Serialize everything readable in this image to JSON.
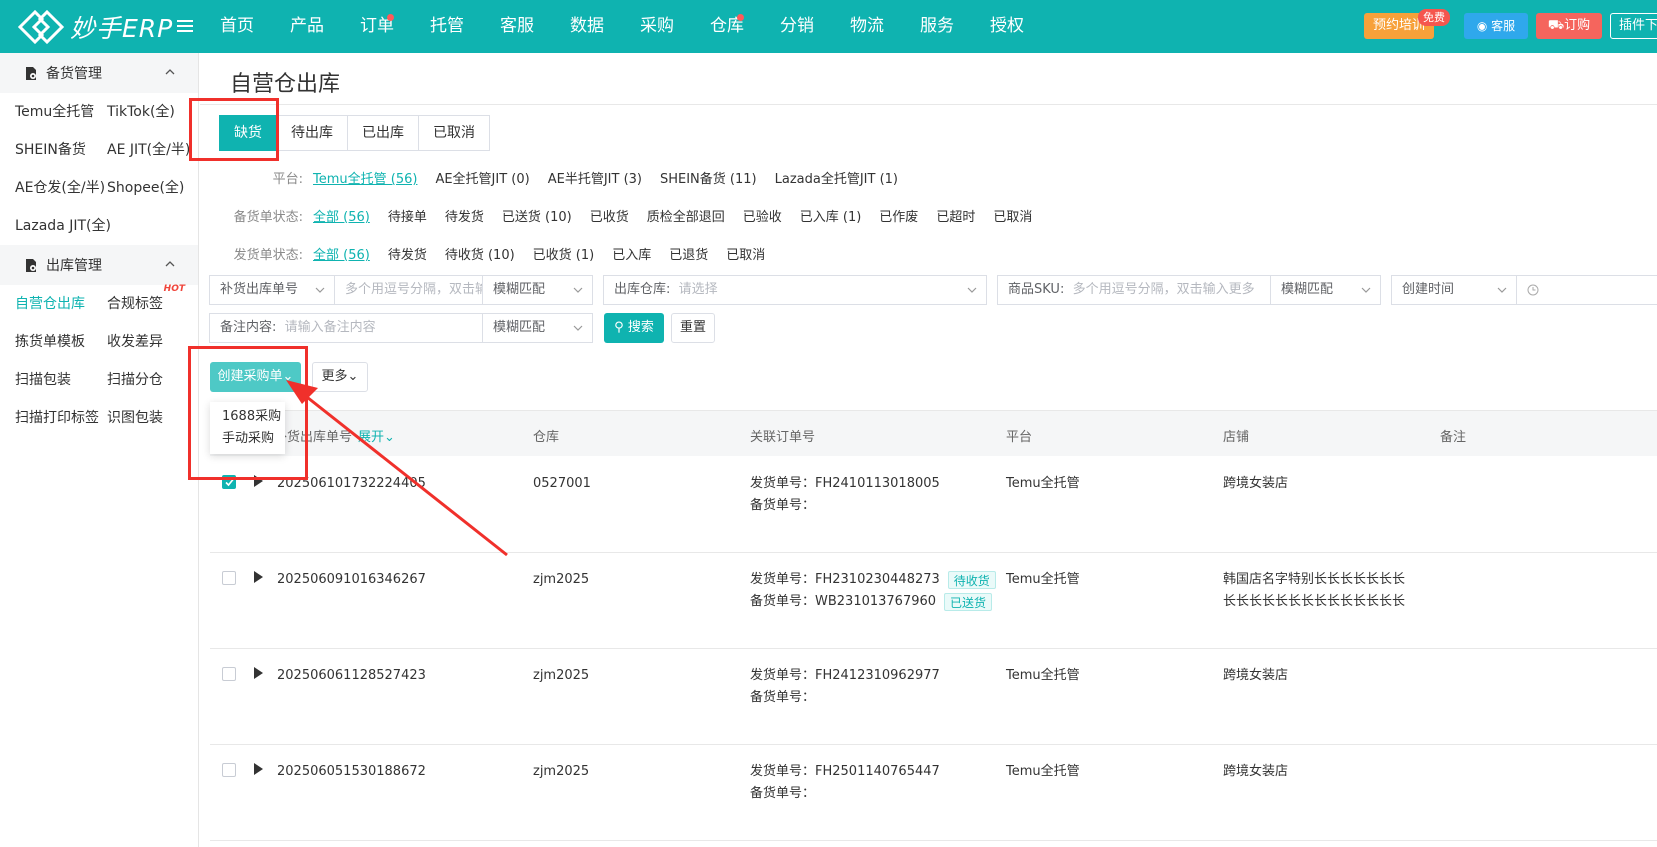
{
  "brand": {
    "name": "妙手ERP"
  },
  "topnav": {
    "items": [
      {
        "label": "首页",
        "dot": false
      },
      {
        "label": "产品",
        "dot": false
      },
      {
        "label": "订单",
        "dot": true
      },
      {
        "label": "托管",
        "dot": false
      },
      {
        "label": "客服",
        "dot": false
      },
      {
        "label": "数据",
        "dot": false
      },
      {
        "label": "采购",
        "dot": false
      },
      {
        "label": "仓库",
        "dot": true
      },
      {
        "label": "分销",
        "dot": false
      },
      {
        "label": "物流",
        "dot": false
      },
      {
        "label": "服务",
        "dot": false
      },
      {
        "label": "授权",
        "dot": false
      }
    ],
    "train_label": "预约培训",
    "free_badge": "免费",
    "cs_label": "客服",
    "order_label": "订购",
    "plugin_label": "插件下载"
  },
  "sidebar": {
    "sections": [
      {
        "title": "备货管理",
        "items": [
          {
            "label": "Temu全托管",
            "active": false
          },
          {
            "label": "TikTok(全)",
            "active": false
          },
          {
            "label": "SHEIN备货",
            "active": false
          },
          {
            "label": "AE JIT(全/半)",
            "active": false
          },
          {
            "label": "AE仓发(全/半)",
            "active": false
          },
          {
            "label": "Shopee(全)",
            "active": false
          },
          {
            "label": "Lazada JIT(全)",
            "active": false
          }
        ]
      },
      {
        "title": "出库管理",
        "items": [
          {
            "label": "自营仓出库",
            "active": true
          },
          {
            "label": "合规标签",
            "active": false,
            "hot": "HOT"
          },
          {
            "label": "拣货单模板",
            "active": false
          },
          {
            "label": "收发差异",
            "active": false
          },
          {
            "label": "扫描包装",
            "active": false
          },
          {
            "label": "扫描分仓",
            "active": false
          },
          {
            "label": "扫描打印标签",
            "active": false
          },
          {
            "label": "识图包装",
            "active": false
          }
        ]
      }
    ]
  },
  "page": {
    "title": "自营仓出库",
    "tabs": [
      {
        "label": "缺货",
        "active": true
      },
      {
        "label": "待出库",
        "active": false
      },
      {
        "label": "已出库",
        "active": false
      },
      {
        "label": "已取消",
        "active": false
      }
    ]
  },
  "filters": {
    "platform": {
      "label": "平台:",
      "options": [
        {
          "label": "Temu全托管 (56)",
          "selected": true
        },
        {
          "label": "AE全托管JIT (0)",
          "selected": false
        },
        {
          "label": "AE半托管JIT (3)",
          "selected": false
        },
        {
          "label": "SHEIN备货 (11)",
          "selected": false
        },
        {
          "label": "Lazada全托管JIT (1)",
          "selected": false
        }
      ]
    },
    "stock_status": {
      "label": "备货单状态:",
      "options": [
        {
          "label": "全部 (56)",
          "selected": true
        },
        {
          "label": "待接单",
          "selected": false
        },
        {
          "label": "待发货",
          "selected": false
        },
        {
          "label": "已送货 (10)",
          "selected": false
        },
        {
          "label": "已收货",
          "selected": false
        },
        {
          "label": "质检全部退回",
          "selected": false
        },
        {
          "label": "已验收",
          "selected": false
        },
        {
          "label": "已入库 (1)",
          "selected": false
        },
        {
          "label": "已作废",
          "selected": false
        },
        {
          "label": "已超时",
          "selected": false
        },
        {
          "label": "已取消",
          "selected": false
        }
      ]
    },
    "ship_status": {
      "label": "发货单状态:",
      "options": [
        {
          "label": "全部 (56)",
          "selected": true
        },
        {
          "label": "待发货",
          "selected": false
        },
        {
          "label": "待收货 (10)",
          "selected": false
        },
        {
          "label": "已收货 (1)",
          "selected": false
        },
        {
          "label": "已入库",
          "selected": false
        },
        {
          "label": "已退货",
          "selected": false
        },
        {
          "label": "已取消",
          "selected": false
        }
      ]
    }
  },
  "search": {
    "order_type": "补货出库单号",
    "order_placeholder": "多个用逗号分隔，双击输入更多",
    "match1": "模糊匹配",
    "warehouse_label": "出库仓库:",
    "warehouse_placeholder": "请选择",
    "sku_label": "商品SKU:",
    "sku_placeholder": "多个用逗号分隔，双击输入更多",
    "match2": "模糊匹配",
    "time_label": "创建时间",
    "remark_label": "备注内容:",
    "remark_placeholder": "请输入备注内容",
    "match3": "模糊匹配",
    "search_btn": "搜索",
    "reset_btn": "重置"
  },
  "actions": {
    "create_label": "创建采购单",
    "more_label": "更多",
    "dropdown": [
      "1688采购",
      "手动采购"
    ]
  },
  "table": {
    "headers": {
      "order": "补货出库单号",
      "expand": "展开",
      "warehouse": "仓库",
      "linked": "关联订单号",
      "platform": "平台",
      "store": "店铺",
      "remark": "备注"
    },
    "ship_prefix": "发货单号：",
    "stock_prefix": "备货单号：",
    "rows": [
      {
        "checked": true,
        "order": "202506101732224405",
        "warehouse": "0527001",
        "ship_no": "FH2410113018005",
        "ship_tag": "",
        "stock_no": "",
        "stock_tag": "",
        "platform": "Temu全托管",
        "store": "跨境女装店",
        "store2": ""
      },
      {
        "checked": false,
        "order": "202506091016346267",
        "warehouse": "zjm2025",
        "ship_no": "FH2310230448273",
        "ship_tag": "待收货",
        "stock_no": "WB231013767960",
        "stock_tag": "已送货",
        "platform": "Temu全托管",
        "store": "韩国店名字特别长长长长长长长",
        "store2": "长长长长长长长长长长长长长长"
      },
      {
        "checked": false,
        "order": "202506061128527423",
        "warehouse": "zjm2025",
        "ship_no": "FH2412310962977",
        "ship_tag": "",
        "stock_no": "",
        "stock_tag": "",
        "platform": "Temu全托管",
        "store": "跨境女装店",
        "store2": ""
      },
      {
        "checked": false,
        "order": "202506051530188672",
        "warehouse": "zjm2025",
        "ship_no": "FH2501140765447",
        "ship_tag": "",
        "stock_no": "",
        "stock_tag": "",
        "platform": "Temu全托管",
        "store": "跨境女装店",
        "store2": ""
      }
    ]
  },
  "colors": {
    "accent": "#0fb3b0",
    "highlight": "#f0302b"
  }
}
